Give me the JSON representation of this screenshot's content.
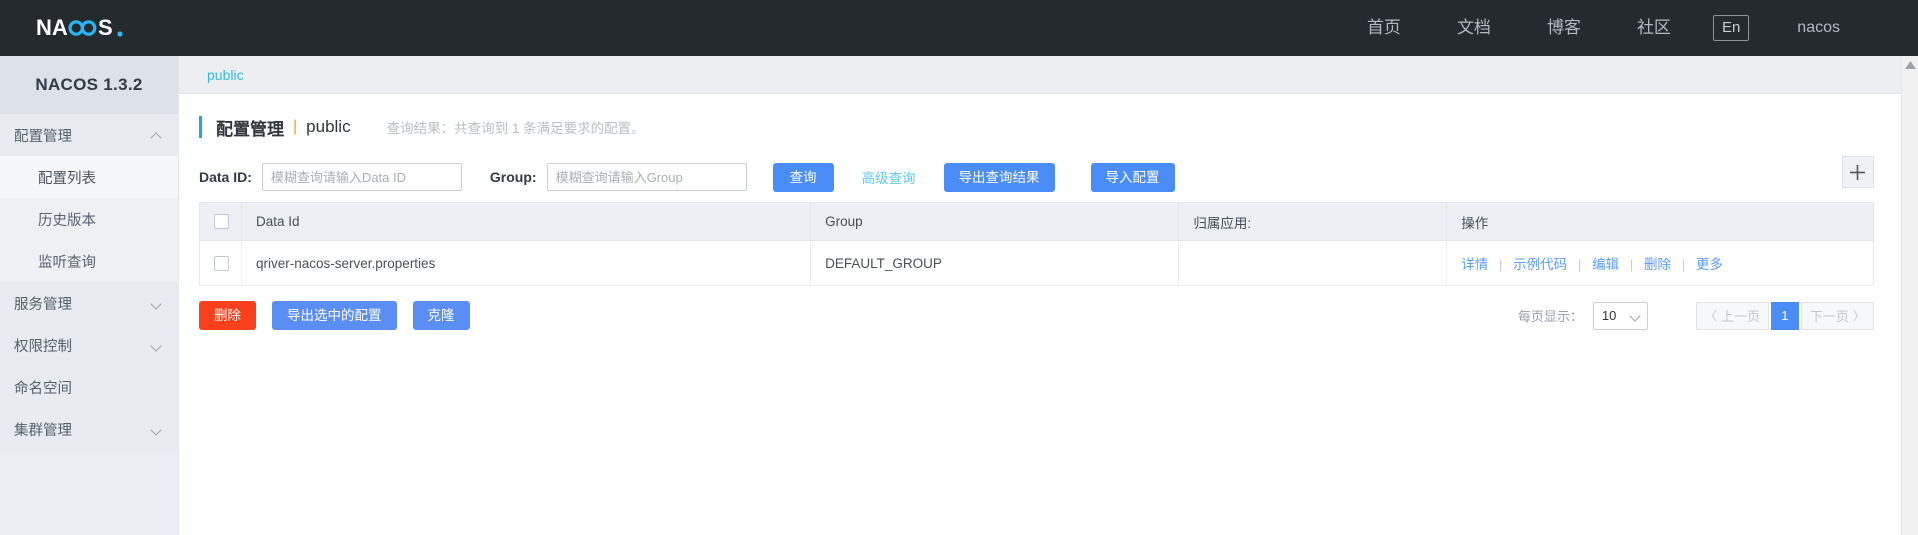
{
  "topbar": {
    "logo_text": "NACOS.",
    "nav": [
      {
        "label": "首页"
      },
      {
        "label": "文档"
      },
      {
        "label": "博客"
      },
      {
        "label": "社区"
      }
    ],
    "lang_toggle": "En",
    "user": "nacos"
  },
  "sidebar": {
    "title": "NACOS 1.3.2",
    "items": [
      {
        "label": "配置管理",
        "type": "group",
        "expanded": true
      },
      {
        "label": "配置列表",
        "type": "sub",
        "active": true
      },
      {
        "label": "历史版本",
        "type": "sub",
        "active": false
      },
      {
        "label": "监听查询",
        "type": "sub",
        "active": false
      },
      {
        "label": "服务管理",
        "type": "group",
        "expanded": false
      },
      {
        "label": "权限控制",
        "type": "group",
        "expanded": false
      },
      {
        "label": "命名空间",
        "type": "plain"
      },
      {
        "label": "集群管理",
        "type": "group",
        "expanded": false
      }
    ]
  },
  "namespace_tab": "public",
  "page": {
    "title": "配置管理",
    "separator": "|",
    "namespace": "public",
    "result_note": "查询结果：共查询到 1 条满足要求的配置。"
  },
  "search": {
    "dataid_label": "Data ID:",
    "dataid_value": "",
    "dataid_placeholder": "模糊查询请输入Data ID",
    "group_label": "Group:",
    "group_value": "",
    "group_placeholder": "模糊查询请输入Group",
    "query_button": "查询",
    "advanced_link": "高级查询",
    "export_button": "导出查询结果",
    "import_button": "导入配置",
    "add_icon": "plus-icon"
  },
  "table": {
    "headers": {
      "checkbox": "",
      "data_id": "Data Id",
      "group": "Group",
      "app": "归属应用:",
      "operation": "操作"
    },
    "rows": [
      {
        "data_id": "qriver-nacos-server.properties",
        "group": "DEFAULT_GROUP",
        "app": "",
        "ops": [
          "详情",
          "示例代码",
          "编辑",
          "删除",
          "更多"
        ],
        "op_divider": "|"
      }
    ]
  },
  "footer": {
    "delete_button": "删除",
    "export_selected_button": "导出选中的配置",
    "clone_button": "克隆",
    "page_size_label": "每页显示：",
    "page_size_value": "10",
    "prev_label": "上一页",
    "next_label": "下一页",
    "current_page": "1",
    "prev_arrow": "〈",
    "next_arrow": "〉"
  },
  "colors": {
    "topbar_bg": "#252a2f",
    "primary_blue": "#4a8df6",
    "danger_red": "#fa3f1d",
    "link_cyan": "#33bbdd",
    "accent_bar": "#1aabd8",
    "sidebar_bg": "#eaedf1"
  }
}
